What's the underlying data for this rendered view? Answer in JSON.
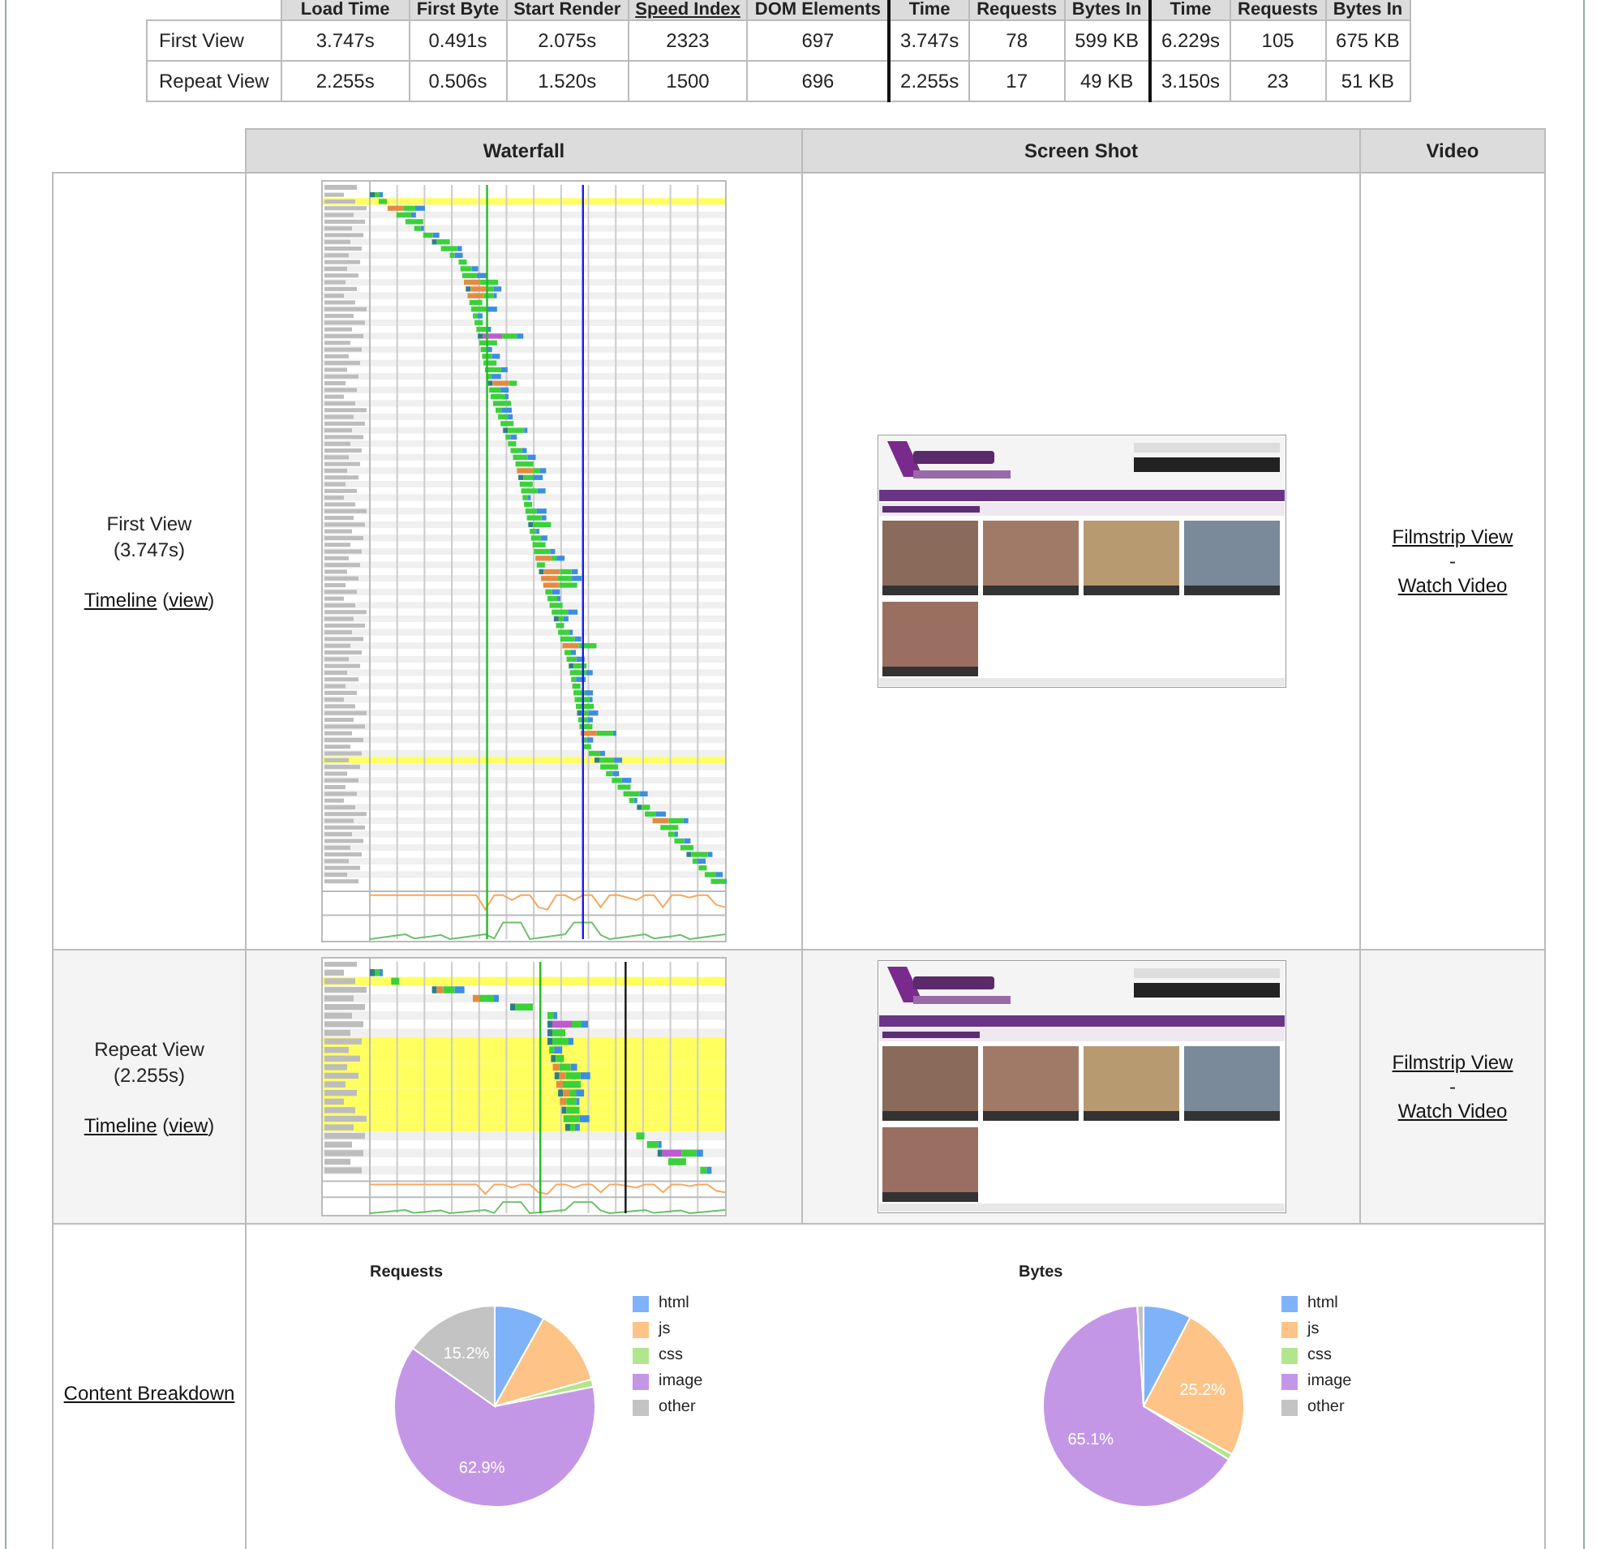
{
  "summary_table": {
    "columns": [
      {
        "label": "Load Time",
        "link": false
      },
      {
        "label": "First Byte",
        "link": false
      },
      {
        "label": "Start Render",
        "link": false
      },
      {
        "label": "Speed Index",
        "link": true
      },
      {
        "label": "DOM Elements",
        "link": false
      },
      {
        "label": "Time",
        "link": false
      },
      {
        "label": "Requests",
        "link": false
      },
      {
        "label": "Bytes In",
        "link": false
      },
      {
        "label": "Time",
        "link": false
      },
      {
        "label": "Requests",
        "link": false
      },
      {
        "label": "Bytes In",
        "link": false
      }
    ],
    "rows": [
      {
        "label": "First View",
        "cells": [
          "3.747s",
          "0.491s",
          "2.075s",
          "2323",
          "697",
          "3.747s",
          "78",
          "599 KB",
          "6.229s",
          "105",
          "675 KB"
        ]
      },
      {
        "label": "Repeat View",
        "cells": [
          "2.255s",
          "0.506s",
          "1.520s",
          "1500",
          "696",
          "2.255s",
          "17",
          "49 KB",
          "3.150s",
          "23",
          "51 KB"
        ]
      }
    ]
  },
  "results_table": {
    "columns": [
      "Waterfall",
      "Screen Shot",
      "Video"
    ],
    "views": [
      {
        "kind": "first",
        "title": "First View",
        "time": "(3.747s)",
        "timeline_link": "Timeline",
        "view_prefix": "(",
        "view_link": "view",
        "view_suffix": ")",
        "filmstrip_link": "Filmstrip View",
        "separator": "-",
        "video_link": "Watch Video"
      },
      {
        "kind": "repeat",
        "title": "Repeat View",
        "time": "(2.255s)",
        "timeline_link": "Timeline",
        "view_prefix": "(",
        "view_link": "view",
        "view_suffix": ")",
        "filmstrip_link": "Filmstrip View",
        "separator": "-",
        "video_link": "Watch Video"
      }
    ],
    "content_breakdown": {
      "link": "Content Breakdown",
      "charts": [
        {
          "chart_data": {
            "type": "pie",
            "title": "Requests",
            "categories": [
              "html",
              "js",
              "css",
              "image",
              "other"
            ],
            "values": [
              8.1,
              12.6,
              1.2,
              62.9,
              15.2
            ],
            "colors": [
              "#7fb3f9",
              "#fec387",
              "#b1e68e",
              "#c497e6",
              "#c3c3c3"
            ],
            "value_labels": [
              null,
              null,
              null,
              "62.9%",
              "15.2%"
            ],
            "legend": "right"
          }
        },
        {
          "chart_data": {
            "type": "pie",
            "title": "Bytes",
            "categories": [
              "html",
              "js",
              "css",
              "image",
              "other"
            ],
            "values": [
              7.7,
              25.2,
              1.0,
              65.1,
              1.0
            ],
            "colors": [
              "#7fb3f9",
              "#fec387",
              "#b1e68e",
              "#c497e6",
              "#c3c3c3"
            ],
            "value_labels": [
              null,
              "25.2%",
              null,
              "65.1%",
              null
            ],
            "legend": "right"
          }
        }
      ]
    }
  }
}
